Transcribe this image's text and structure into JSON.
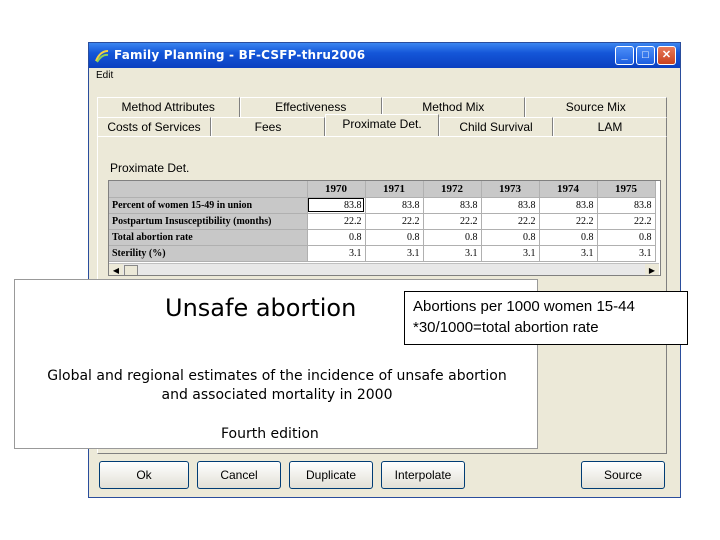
{
  "window": {
    "title": "Family Planning - BF-CSFP-thru2006",
    "menu": "Edit",
    "colors": {
      "titlebar": "#1456d8",
      "face": "#ece9d8"
    }
  },
  "tabs": {
    "row1": [
      "Method Attributes",
      "Effectiveness",
      "Method Mix",
      "Source Mix"
    ],
    "row2": [
      "Costs of Services",
      "Fees",
      "Proximate Det.",
      "Child Survival",
      "LAM"
    ],
    "active": "Proximate Det."
  },
  "panel": {
    "title": "Proximate Det."
  },
  "grid": {
    "years": [
      "1970",
      "1971",
      "1972",
      "1973",
      "1974",
      "1975"
    ],
    "rows": [
      {
        "label": "Percent of women 15-49 in union",
        "values": [
          "83.8",
          "83.8",
          "83.8",
          "83.8",
          "83.8",
          "83.8"
        ]
      },
      {
        "label": "Postpartum Insusceptibility (months)",
        "values": [
          "22.2",
          "22.2",
          "22.2",
          "22.2",
          "22.2",
          "22.2"
        ]
      },
      {
        "label": "Total abortion rate",
        "values": [
          "0.8",
          "0.8",
          "0.8",
          "0.8",
          "0.8",
          "0.8"
        ]
      },
      {
        "label": "Sterility (%)",
        "values": [
          "3.1",
          "3.1",
          "3.1",
          "3.1",
          "3.1",
          "3.1"
        ]
      }
    ]
  },
  "buttons": [
    "Ok",
    "Cancel",
    "Duplicate",
    "Interpolate",
    "Source"
  ],
  "overlay": {
    "title": "Unsafe abortion",
    "subtitle_line1": "Global and regional estimates of the incidence of unsafe abortion",
    "subtitle_line2": "and associated mortality in 2000",
    "edition": "Fourth edition"
  },
  "callout": {
    "line1": "Abortions per 1000 women 15-44",
    "line2": "*30/1000=total abortion rate"
  }
}
